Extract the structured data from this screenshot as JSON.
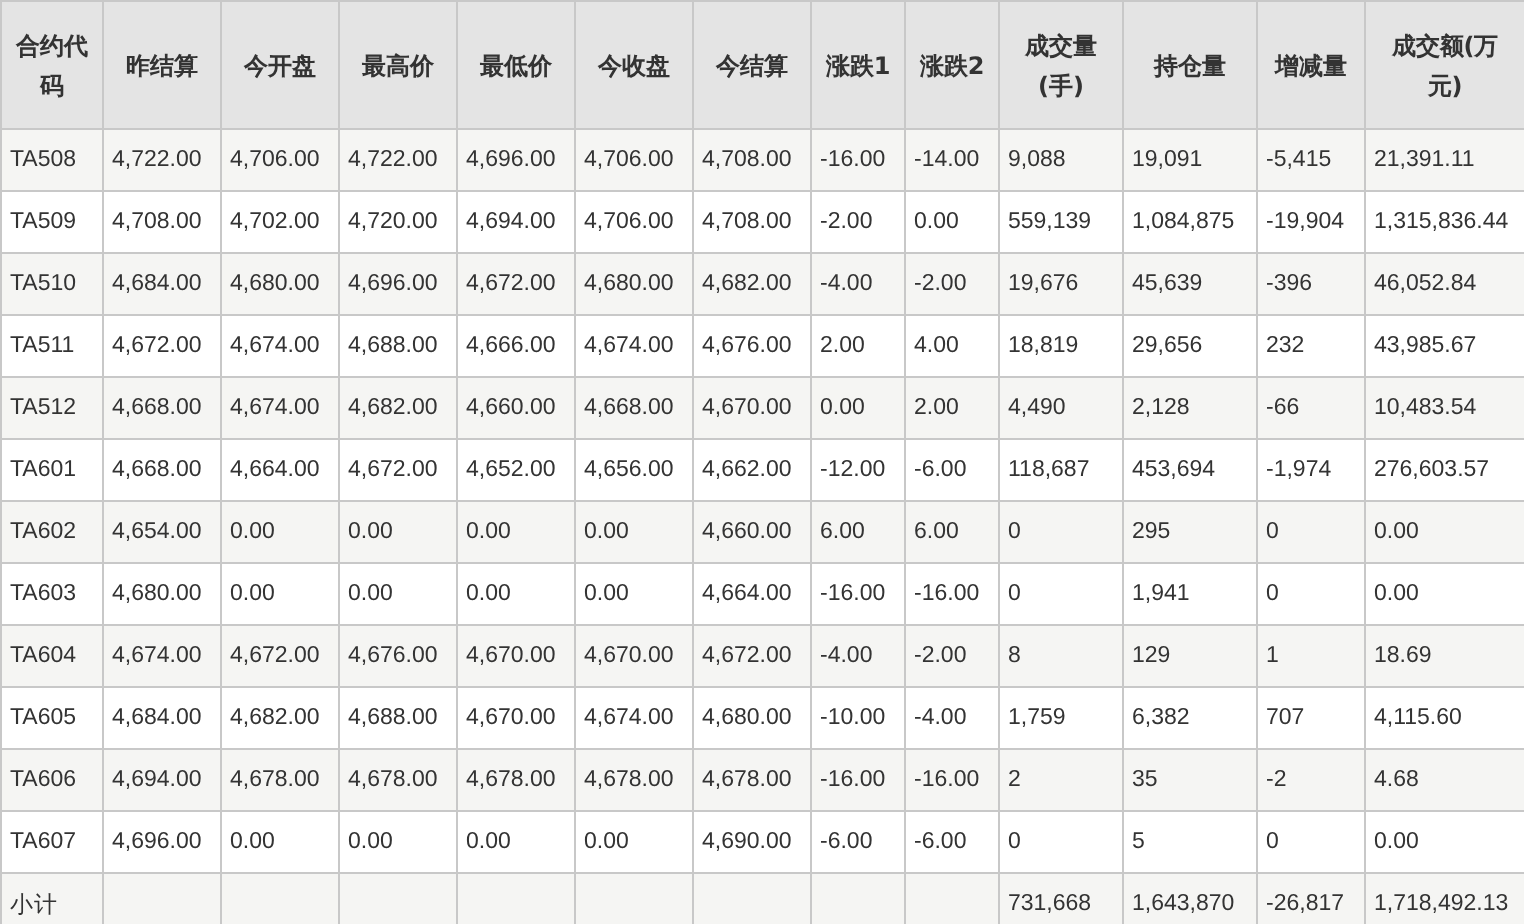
{
  "table": {
    "columns": [
      "合约代码",
      "昨结算",
      "今开盘",
      "最高价",
      "最低价",
      "今收盘",
      "今结算",
      "涨跌1",
      "涨跌2",
      "成交量(手)",
      "持仓量",
      "增减量",
      "成交额(万元)"
    ],
    "rows": [
      {
        "cells": [
          "TA508",
          "4,722.00",
          "4,706.00",
          "4,722.00",
          "4,696.00",
          "4,706.00",
          "4,708.00",
          "-16.00",
          "-14.00",
          "9,088",
          "19,091",
          "-5,415",
          "21,391.11"
        ]
      },
      {
        "cells": [
          "TA509",
          "4,708.00",
          "4,702.00",
          "4,720.00",
          "4,694.00",
          "4,706.00",
          "4,708.00",
          "-2.00",
          "0.00",
          "559,139",
          "1,084,875",
          "-19,904",
          "1,315,836.44"
        ]
      },
      {
        "cells": [
          "TA510",
          "4,684.00",
          "4,680.00",
          "4,696.00",
          "4,672.00",
          "4,680.00",
          "4,682.00",
          "-4.00",
          "-2.00",
          "19,676",
          "45,639",
          "-396",
          "46,052.84"
        ]
      },
      {
        "cells": [
          "TA511",
          "4,672.00",
          "4,674.00",
          "4,688.00",
          "4,666.00",
          "4,674.00",
          "4,676.00",
          "2.00",
          "4.00",
          "18,819",
          "29,656",
          "232",
          "43,985.67"
        ]
      },
      {
        "cells": [
          "TA512",
          "4,668.00",
          "4,674.00",
          "4,682.00",
          "4,660.00",
          "4,668.00",
          "4,670.00",
          "0.00",
          "2.00",
          "4,490",
          "2,128",
          "-66",
          "10,483.54"
        ]
      },
      {
        "cells": [
          "TA601",
          "4,668.00",
          "4,664.00",
          "4,672.00",
          "4,652.00",
          "4,656.00",
          "4,662.00",
          "-12.00",
          "-6.00",
          "118,687",
          "453,694",
          "-1,974",
          "276,603.57"
        ]
      },
      {
        "cells": [
          "TA602",
          "4,654.00",
          "0.00",
          "0.00",
          "0.00",
          "0.00",
          "4,660.00",
          "6.00",
          "6.00",
          "0",
          "295",
          "0",
          "0.00"
        ]
      },
      {
        "cells": [
          "TA603",
          "4,680.00",
          "0.00",
          "0.00",
          "0.00",
          "0.00",
          "4,664.00",
          "-16.00",
          "-16.00",
          "0",
          "1,941",
          "0",
          "0.00"
        ]
      },
      {
        "cells": [
          "TA604",
          "4,674.00",
          "4,672.00",
          "4,676.00",
          "4,670.00",
          "4,670.00",
          "4,672.00",
          "-4.00",
          "-2.00",
          "8",
          "129",
          "1",
          "18.69"
        ]
      },
      {
        "cells": [
          "TA605",
          "4,684.00",
          "4,682.00",
          "4,688.00",
          "4,670.00",
          "4,674.00",
          "4,680.00",
          "-10.00",
          "-4.00",
          "1,759",
          "6,382",
          "707",
          "4,115.60"
        ]
      },
      {
        "cells": [
          "TA606",
          "4,694.00",
          "4,678.00",
          "4,678.00",
          "4,678.00",
          "4,678.00",
          "4,678.00",
          "-16.00",
          "-16.00",
          "2",
          "35",
          "-2",
          "4.68"
        ]
      },
      {
        "cells": [
          "TA607",
          "4,696.00",
          "0.00",
          "0.00",
          "0.00",
          "0.00",
          "4,690.00",
          "-6.00",
          "-6.00",
          "0",
          "5",
          "0",
          "0.00"
        ]
      }
    ],
    "subtotal": {
      "label": "小计",
      "values": [
        "731,668",
        "1,643,870",
        "-26,817",
        "1,718,492.13"
      ]
    }
  }
}
